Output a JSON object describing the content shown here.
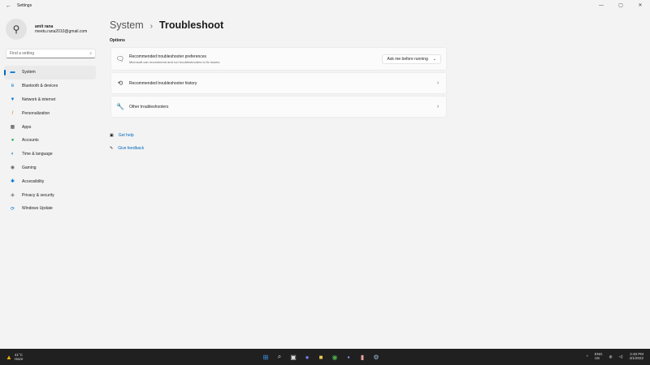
{
  "window": {
    "title": "Settings",
    "minimize": "—",
    "maximize": "▢",
    "close": "✕"
  },
  "profile": {
    "name": "amit rana",
    "email": "meetu.rana2010@gmail.com"
  },
  "search": {
    "placeholder": "Find a setting"
  },
  "nav": [
    {
      "label": "System",
      "icon": "▬",
      "color": "#0078d4"
    },
    {
      "label": "Bluetooth & devices",
      "icon": "ʙ",
      "color": "#0078d4"
    },
    {
      "label": "Network & internet",
      "icon": "▼",
      "color": "#0078d4"
    },
    {
      "label": "Personalization",
      "icon": "/",
      "color": "#c86b00"
    },
    {
      "label": "Apps",
      "icon": "▦",
      "color": "#444"
    },
    {
      "label": "Accounts",
      "icon": "●",
      "color": "#1aa55a"
    },
    {
      "label": "Time & language",
      "icon": "◐",
      "color": "#0078d4"
    },
    {
      "label": "Gaming",
      "icon": "◉",
      "color": "#666"
    },
    {
      "label": "Accessibility",
      "icon": "✱",
      "color": "#0078d4"
    },
    {
      "label": "Privacy & security",
      "icon": "◈",
      "color": "#777"
    },
    {
      "label": "Windows Update",
      "icon": "⟳",
      "color": "#0078d4"
    }
  ],
  "breadcrumb": {
    "parent": "System",
    "separator": "›",
    "current": "Troubleshoot"
  },
  "section": "Options",
  "cards": {
    "prefs": {
      "title": "Recommended troubleshooter preferences",
      "subtitle": "Microsoft can recommend and run troubleshooters to fix issues",
      "dropdown": "Ask me before running"
    },
    "history": {
      "title": "Recommended troubleshooter history"
    },
    "other": {
      "title": "Other troubleshooters"
    }
  },
  "links": {
    "help": "Get help",
    "feedback": "Give feedback"
  },
  "taskbar": {
    "temp": "41°C",
    "condition": "Haze",
    "lang1": "ENG",
    "lang2": "US",
    "time": "2:48 PM",
    "date": "4/1/2022"
  }
}
